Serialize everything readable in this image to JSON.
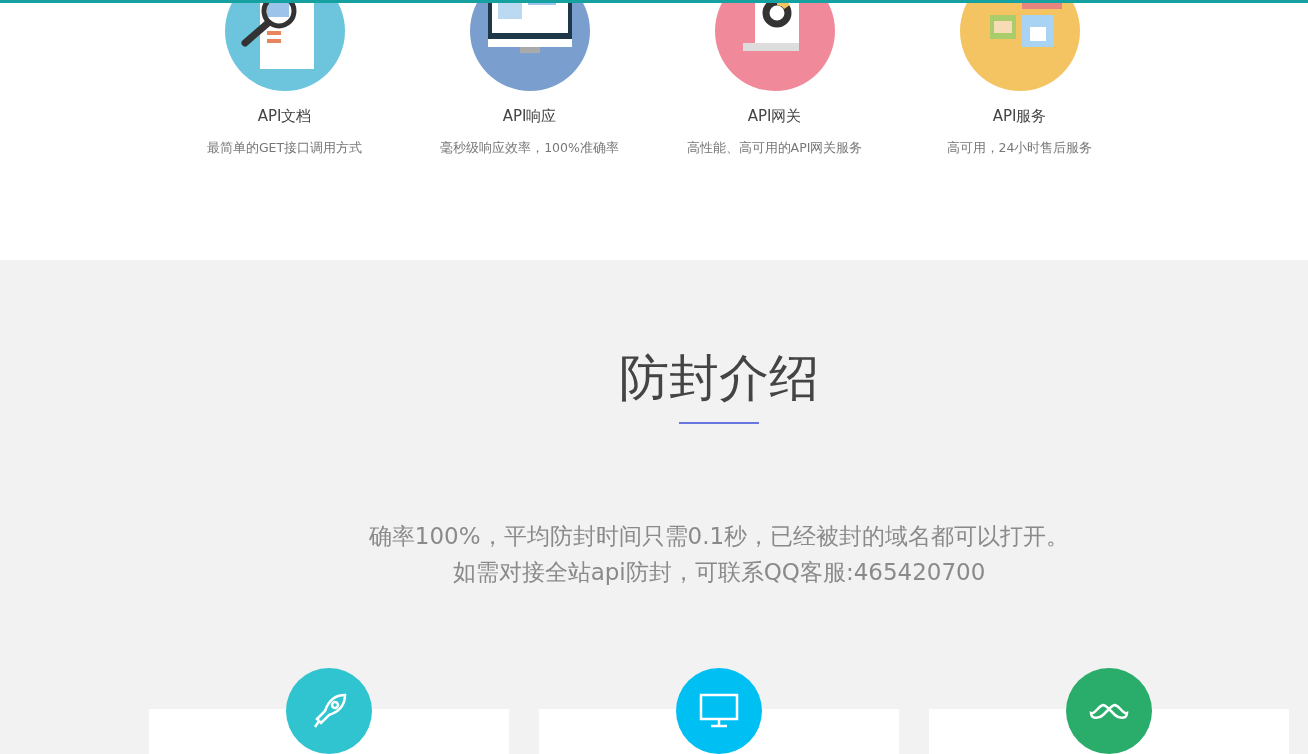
{
  "features": [
    {
      "kind": "docs",
      "title": "API文档",
      "description": "最简单的GET接口调用方式"
    },
    {
      "kind": "response",
      "title": "API响应",
      "description": "毫秒级响应效率，100%准确率"
    },
    {
      "kind": "gateway",
      "title": "API网关",
      "description": "高性能、高可用的API网关服务"
    },
    {
      "kind": "service",
      "title": "API服务",
      "description": "高可用，24小时售后服务"
    }
  ],
  "intro": {
    "title": "防封介绍",
    "lines": [
      "确率100%，平均防封时间只需0.1秒，已经被封的域名都可以打开。",
      "如需对接全站api防封，可联系QQ客服:465420700"
    ]
  },
  "cards": [
    {
      "kind": "rocket"
    },
    {
      "kind": "monitor"
    },
    {
      "kind": "mustache"
    }
  ]
}
